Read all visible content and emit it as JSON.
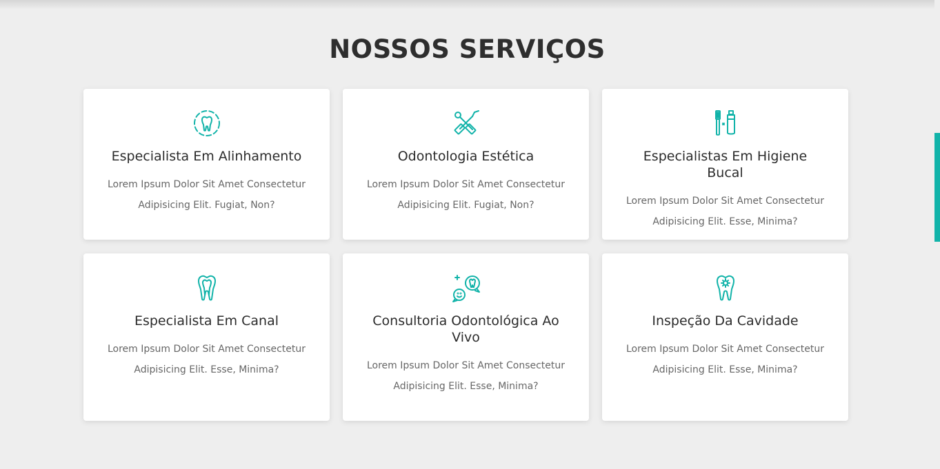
{
  "section": {
    "title": "NOSSOS SERVIÇOS"
  },
  "colors": {
    "accent": "#11b3a9",
    "background": "#eeeeee",
    "card": "#ffffff"
  },
  "services": [
    {
      "icon": "tooth-circle-icon",
      "title": "Especialista Em Alinhamento",
      "description": "Lorem Ipsum Dolor Sit Amet Consectetur Adipisicing Elit. Fugiat, Non?"
    },
    {
      "icon": "dental-tools-icon",
      "title": "Odontologia Estética",
      "description": "Lorem Ipsum Dolor Sit Amet Consectetur Adipisicing Elit. Fugiat, Non?"
    },
    {
      "icon": "toothbrush-toothpaste-icon",
      "title": "Especialistas Em Higiene Bucal",
      "description": "Lorem Ipsum Dolor Sit Amet Consectetur Adipisicing Elit. Esse, Minima?"
    },
    {
      "icon": "tooth-root-icon",
      "title": "Especialista Em Canal",
      "description": "Lorem Ipsum Dolor Sit Amet Consectetur Adipisicing Elit. Esse, Minima?"
    },
    {
      "icon": "chat-tooth-icon",
      "title": "Consultoria Odontológica Ao Vivo",
      "description": "Lorem Ipsum Dolor Sit Amet Consectetur Adipisicing Elit. Esse, Minima?"
    },
    {
      "icon": "tooth-gear-icon",
      "title": "Inspeção Da Cavidade",
      "description": "Lorem Ipsum Dolor Sit Amet Consectetur Adipisicing Elit. Esse, Minima?"
    }
  ]
}
